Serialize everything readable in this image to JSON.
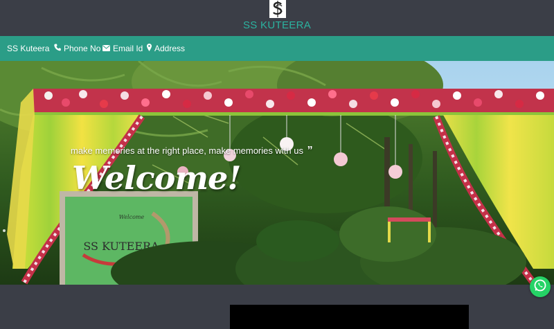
{
  "brand": {
    "name": "SS KUTEERA",
    "logo_icon": "ss-monogram-icon"
  },
  "nav": {
    "items": [
      {
        "label": "SS Kuteera",
        "icon": ""
      },
      {
        "label": "Phone No",
        "icon": "phone-icon"
      },
      {
        "label": "Email Id",
        "icon": "envelope-icon"
      },
      {
        "label": "Address",
        "icon": "map-marker-icon"
      }
    ]
  },
  "hero": {
    "tagline": "make memories at the right place, make memories with us",
    "heading": "Welcome!",
    "sign_text": "SS KUTEERA",
    "sign_small": "Welcome"
  },
  "floating": {
    "whatsapp_icon": "whatsapp-icon"
  },
  "colors": {
    "header_bg": "#3b3e47",
    "nav_bg": "#2b9d87",
    "brand_text": "#2bb3a0",
    "whatsapp": "#25d366"
  }
}
